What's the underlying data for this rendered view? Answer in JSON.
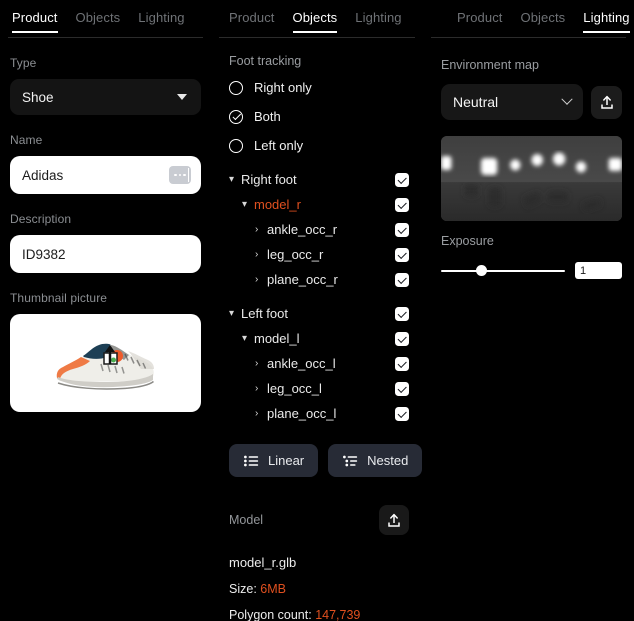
{
  "panels": {
    "product": {
      "tabs": [
        {
          "label": "Product",
          "active": true
        },
        {
          "label": "Objects",
          "active": false
        },
        {
          "label": "Lighting",
          "active": false
        }
      ],
      "type_label": "Type",
      "type_value": "Shoe",
      "name_label": "Name",
      "name_value": "Adidas",
      "description_label": "Description",
      "description_value": "ID9382",
      "thumbnail_label": "Thumbnail picture",
      "thumbnail_alt": "sneaker-thumbnail",
      "upload_icon": "upload-icon"
    },
    "objects": {
      "tabs": [
        {
          "label": "Product",
          "active": false
        },
        {
          "label": "Objects",
          "active": true
        },
        {
          "label": "Lighting",
          "active": false
        }
      ],
      "foot_tracking_label": "Foot tracking",
      "radios": [
        {
          "label": "Right only",
          "checked": false
        },
        {
          "label": "Both",
          "checked": true
        },
        {
          "label": "Left only",
          "checked": false
        }
      ],
      "tree": [
        {
          "label": "Right foot",
          "indent": 1,
          "chevron": "down",
          "checked": true,
          "accent": false
        },
        {
          "label": "model_r",
          "indent": 2,
          "chevron": "down",
          "checked": true,
          "accent": true
        },
        {
          "label": "ankle_occ_r",
          "indent": 3,
          "chevron": "right",
          "checked": true,
          "accent": false
        },
        {
          "label": "leg_occ_r",
          "indent": 3,
          "chevron": "right",
          "checked": true,
          "accent": false
        },
        {
          "label": "plane_occ_r",
          "indent": 3,
          "chevron": "right",
          "checked": true,
          "accent": false
        },
        {
          "label": "Left foot",
          "indent": 1,
          "chevron": "down",
          "checked": true,
          "accent": false
        },
        {
          "label": "model_l",
          "indent": 2,
          "chevron": "down",
          "checked": true,
          "accent": false
        },
        {
          "label": "ankle_occ_l",
          "indent": 3,
          "chevron": "right",
          "checked": true,
          "accent": false
        },
        {
          "label": "leg_occ_l",
          "indent": 3,
          "chevron": "right",
          "checked": true,
          "accent": false
        },
        {
          "label": "plane_occ_l",
          "indent": 3,
          "chevron": "right",
          "checked": true,
          "accent": false
        }
      ],
      "view_linear": "Linear",
      "view_nested": "Nested",
      "model_section_label": "Model",
      "model_upload_icon": "upload-icon",
      "model_filename": "model_r.glb",
      "size_key": "Size:",
      "size_value": "6MB",
      "polygon_key": "Polygon count:",
      "polygon_value": "147,739"
    },
    "lighting": {
      "tabs": [
        {
          "label": "Product",
          "active": false
        },
        {
          "label": "Objects",
          "active": false
        },
        {
          "label": "Lighting",
          "active": true
        }
      ],
      "env_label": "Environment map",
      "env_value": "Neutral",
      "env_upload_icon": "upload-icon",
      "env_preview_alt": "hdri-environment-preview",
      "exposure_label": "Exposure",
      "exposure_value": "1",
      "exposure_percent": 33
    }
  },
  "colors": {
    "accent": "#e0501f",
    "background": "#000000",
    "tab_inactive": "#6f7276",
    "tab_active": "#ffffff",
    "button_slate": "#272b36"
  }
}
